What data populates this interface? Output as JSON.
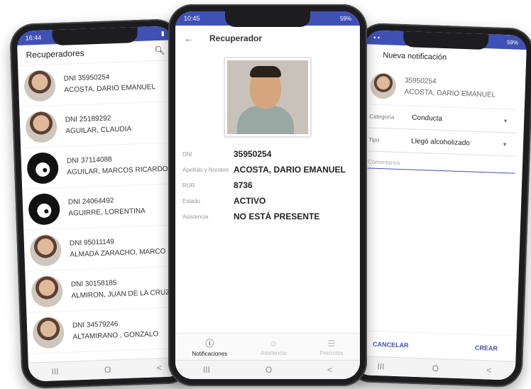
{
  "phone_list": {
    "status_time": "16:44",
    "title": "Recuperadores",
    "items": [
      {
        "dni": "DNI 35950254",
        "name": "ACOSTA, DARIO EMANUEL"
      },
      {
        "dni": "DNI 25189292",
        "name": "AGUILAR, CLAUDIA"
      },
      {
        "dni": "DNI 37114088",
        "name": "AGUILAR, MARCOS RICARDO"
      },
      {
        "dni": "DNI 24064492",
        "name": "AGUIRRE, LORENTINA"
      },
      {
        "dni": "DNI 95011149",
        "name": "ALMADA ZARACHO, MARCO"
      },
      {
        "dni": "DNI 30158185",
        "name": "ALMIRON, JUAN DE LA CRUZ"
      },
      {
        "dni": "DNI 34579246",
        "name": "ALTAMIRANO , GONZALO"
      }
    ]
  },
  "phone_detail": {
    "status_time": "10:45",
    "status_right": "59%",
    "title": "Recuperador",
    "rows": [
      {
        "label": "DNI",
        "value": "35950254"
      },
      {
        "label": "Apellido y Nombre",
        "value": "ACOSTA, DARIO EMANUEL"
      },
      {
        "label": "RUR",
        "value": "8736"
      },
      {
        "label": "Estado",
        "value": "ACTIVO"
      },
      {
        "label": "Asistencia",
        "value": "NO ESTÁ PRESENTE"
      }
    ],
    "tabs": [
      "Notificaciones",
      "Asistencia",
      "Precintos"
    ]
  },
  "phone_notif": {
    "status_right": "59%",
    "title": "Nueva notificación",
    "user_dni": "35950254",
    "user_name": "ACOSTA, DARIO EMANUEL",
    "categoria_label": "Categoría",
    "categoria_value": "Conducta",
    "tipo_label": "Tipo",
    "tipo_value": "Llegó alcoholizado",
    "comment_placeholder": "Comentarios",
    "cancel": "CANCELAR",
    "create": "CREAR"
  },
  "nav": {
    "recents": "III",
    "home": "O",
    "back": "<"
  }
}
